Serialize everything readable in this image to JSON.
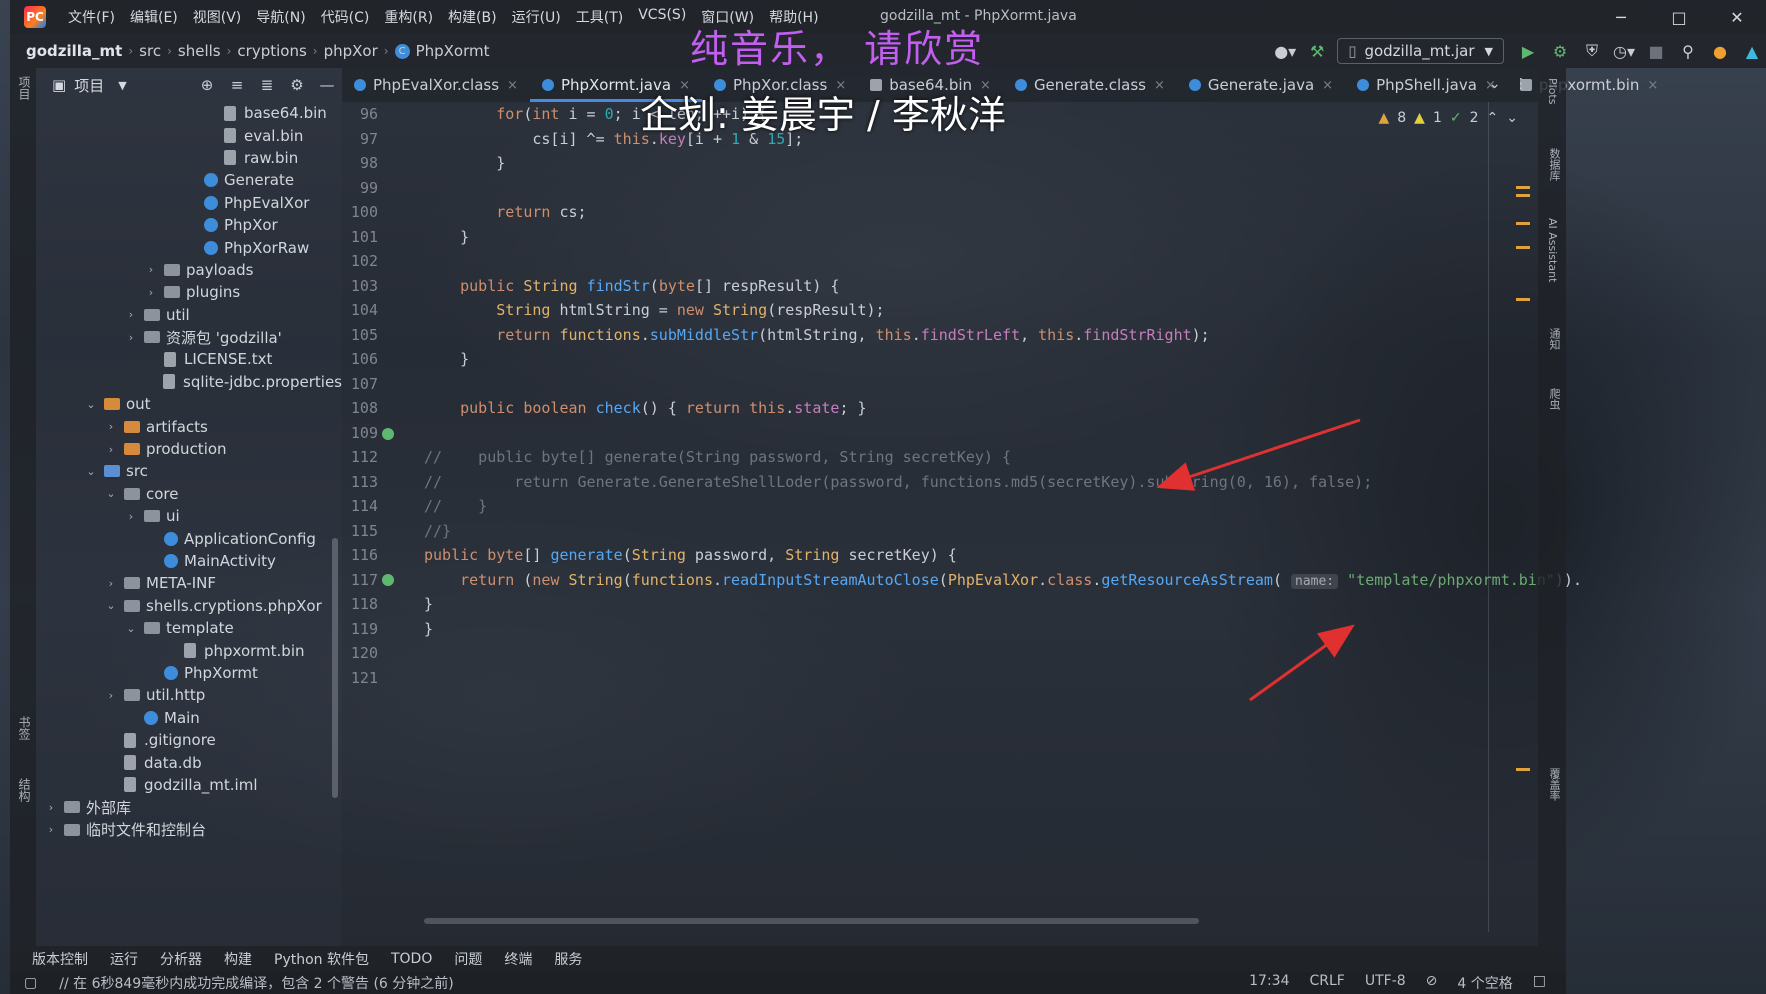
{
  "window": {
    "title": "godzilla_mt - PhpXormt.java",
    "menu": [
      "文件(F)",
      "编辑(E)",
      "视图(V)",
      "导航(N)",
      "代码(C)",
      "重构(R)",
      "构建(B)",
      "运行(U)",
      "工具(T)",
      "VCS(S)",
      "窗口(W)",
      "帮助(H)"
    ],
    "controls": [
      "─",
      "□",
      "✕"
    ]
  },
  "breadcrumb": [
    "godzilla_mt",
    "src",
    "shells",
    "cryptions",
    "phpXor",
    "PhpXormt"
  ],
  "toolbar": {
    "run_config": "godzilla_mt.jar"
  },
  "left_strip": {
    "project": "项目",
    "bookmarks": "书签",
    "structure": "结构"
  },
  "project_panel": {
    "header": "项目",
    "tree": [
      {
        "label": "base64.bin",
        "depth": 8,
        "kind": "file",
        "chev": ""
      },
      {
        "label": "eval.bin",
        "depth": 8,
        "kind": "file",
        "chev": ""
      },
      {
        "label": "raw.bin",
        "depth": 8,
        "kind": "file",
        "chev": ""
      },
      {
        "label": "Generate",
        "depth": 7,
        "kind": "class",
        "chev": ""
      },
      {
        "label": "PhpEvalXor",
        "depth": 7,
        "kind": "class",
        "chev": ""
      },
      {
        "label": "PhpXor",
        "depth": 7,
        "kind": "class",
        "chev": ""
      },
      {
        "label": "PhpXorRaw",
        "depth": 7,
        "kind": "class",
        "chev": ""
      },
      {
        "label": "payloads",
        "depth": 5,
        "kind": "folder",
        "chev": ">"
      },
      {
        "label": "plugins",
        "depth": 5,
        "kind": "folder",
        "chev": ">"
      },
      {
        "label": "util",
        "depth": 4,
        "kind": "folder",
        "chev": ">"
      },
      {
        "label": "资源包 'godzilla'",
        "depth": 4,
        "kind": "folder",
        "chev": ">"
      },
      {
        "label": "LICENSE.txt",
        "depth": 5,
        "kind": "file",
        "chev": ""
      },
      {
        "label": "sqlite-jdbc.properties",
        "depth": 5,
        "kind": "file",
        "chev": ""
      },
      {
        "label": "out",
        "depth": 2,
        "kind": "orange",
        "chev": "v"
      },
      {
        "label": "artifacts",
        "depth": 3,
        "kind": "orange",
        "chev": ">"
      },
      {
        "label": "production",
        "depth": 3,
        "kind": "orange",
        "chev": ">"
      },
      {
        "label": "src",
        "depth": 2,
        "kind": "blue",
        "chev": "v"
      },
      {
        "label": "core",
        "depth": 3,
        "kind": "folder",
        "chev": "v"
      },
      {
        "label": "ui",
        "depth": 4,
        "kind": "folder",
        "chev": ">"
      },
      {
        "label": "ApplicationConfig",
        "depth": 5,
        "kind": "class",
        "chev": ""
      },
      {
        "label": "MainActivity",
        "depth": 5,
        "kind": "class",
        "chev": ""
      },
      {
        "label": "META-INF",
        "depth": 3,
        "kind": "folder",
        "chev": ">"
      },
      {
        "label": "shells.cryptions.phpXor",
        "depth": 3,
        "kind": "folder",
        "chev": "v"
      },
      {
        "label": "template",
        "depth": 4,
        "kind": "folder",
        "chev": "v"
      },
      {
        "label": "phpxormt.bin",
        "depth": 6,
        "kind": "file",
        "chev": ""
      },
      {
        "label": "PhpXormt",
        "depth": 5,
        "kind": "class",
        "chev": ""
      },
      {
        "label": "util.http",
        "depth": 3,
        "kind": "folder",
        "chev": ">"
      },
      {
        "label": "Main",
        "depth": 4,
        "kind": "class",
        "chev": ""
      },
      {
        "label": ".gitignore",
        "depth": 3,
        "kind": "file",
        "chev": ""
      },
      {
        "label": "data.db",
        "depth": 3,
        "kind": "file",
        "chev": ""
      },
      {
        "label": "godzilla_mt.iml",
        "depth": 3,
        "kind": "file",
        "chev": ""
      },
      {
        "label": "外部库",
        "depth": 0,
        "kind": "folder",
        "chev": ">"
      },
      {
        "label": "临时文件和控制台",
        "depth": 0,
        "kind": "folder",
        "chev": ">"
      }
    ]
  },
  "tabs": [
    {
      "label": "PhpEvalXor.class",
      "active": false
    },
    {
      "label": "PhpXormt.java",
      "active": true
    },
    {
      "label": "PhpXor.class",
      "active": false
    },
    {
      "label": "base64.bin",
      "active": false
    },
    {
      "label": "Generate.class",
      "active": false
    },
    {
      "label": "Generate.java",
      "active": false
    },
    {
      "label": "PhpShell.java",
      "active": false
    },
    {
      "label": "phpxormt.bin",
      "active": false
    }
  ],
  "inspections": {
    "warnings": "8",
    "weak": "1",
    "ok": "2"
  },
  "editor": {
    "line_numbers": [
      "96",
      "97",
      "98",
      "99",
      "100",
      "101",
      "102",
      "103",
      "104",
      "105",
      "106",
      "107",
      "108",
      "109",
      "112",
      "113",
      "114",
      "115",
      "116",
      "117",
      "118",
      "119",
      "120",
      "121"
    ],
    "param_hint": "name:"
  },
  "right_strip": [
    "Plots",
    "数据库",
    "AI Assistant",
    "通知",
    "爬虫",
    "覆盖率"
  ],
  "tool_windows": [
    "版本控制",
    "运行",
    "分析器",
    "构建",
    "Python 软件包",
    "TODO",
    "问题",
    "终端",
    "服务"
  ],
  "status_bar": {
    "message": "// 在 6秒849毫秒内成功完成编译，包含 2 个警告 (6 分钟之前)",
    "position": "17:34",
    "line_sep": "CRLF",
    "encoding": "UTF-8",
    "indent": "4 个空格"
  },
  "overlay": {
    "caption_top": "纯音乐， 请欣赏",
    "caption_credits": "企划: 姜晨宇 / 李秋洋"
  },
  "colors": {
    "accent": "#4a88e8",
    "keyword": "#cf8e6d",
    "function": "#56a8f5",
    "field": "#c77dbb",
    "string": "#6aab73",
    "number": "#2aacb8",
    "arrow": "#e03030"
  }
}
